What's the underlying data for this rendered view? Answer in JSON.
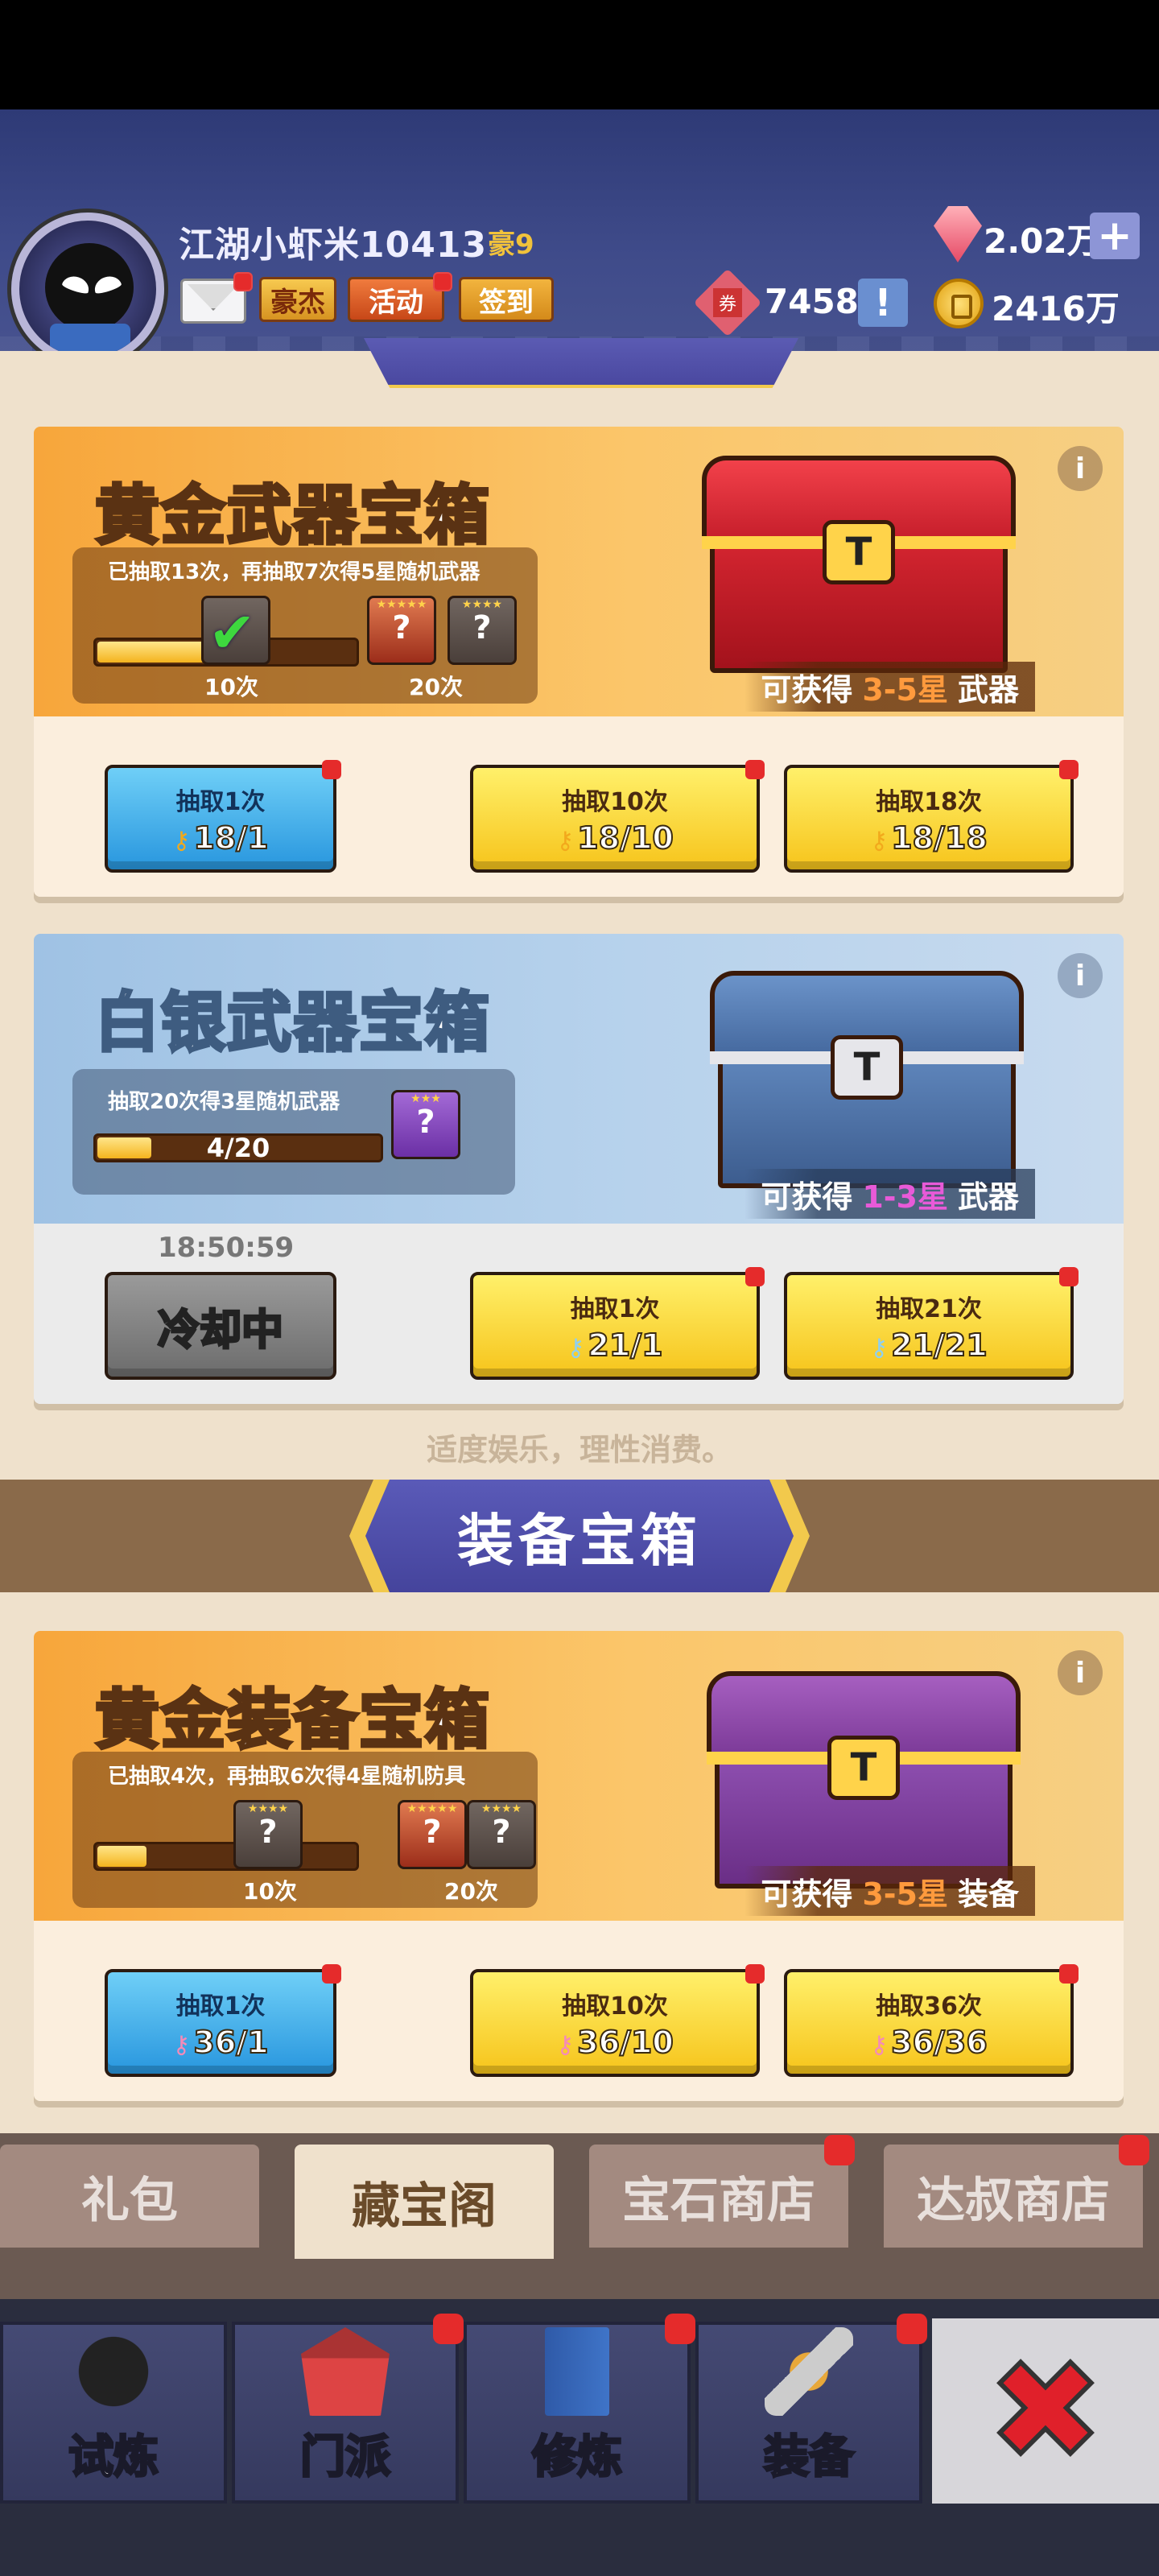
{
  "header": {
    "username": "江湖小虾米10413",
    "vip": "豪9",
    "buttons": {
      "hero": "豪杰",
      "activity": "活动",
      "signin": "签到"
    },
    "gems": "2.02万",
    "tickets": "7458",
    "coins": "2416万",
    "plus": "+",
    "excl": "!",
    "ticket_glyph": "券"
  },
  "cards": {
    "gold_weapon": {
      "title": "黄金武器宝箱",
      "progress_text": "已抽取13次，再抽取7次得5星随机武器",
      "progress": 0.65,
      "mark1": "10次",
      "mark2": "20次",
      "obtain_prefix": "可获得",
      "obtain_stars": "3-5星",
      "obtain_suffix": "武器",
      "btn1": {
        "label": "抽取1次",
        "cost": "18/1"
      },
      "btn2": {
        "label": "抽取10次",
        "cost": "18/10"
      },
      "btn3": {
        "label": "抽取18次",
        "cost": "18/18"
      }
    },
    "silver_weapon": {
      "title": "白银武器宝箱",
      "progress_text": "抽取20次得3星随机武器",
      "progress": 0.2,
      "progress_count": "4/20",
      "obtain_prefix": "可获得",
      "obtain_stars": "1-3星",
      "obtain_suffix": "武器",
      "cooldown_time": "18:50:59",
      "btn_cooldown": "冷却中",
      "btn2": {
        "label": "抽取1次",
        "cost": "21/1"
      },
      "btn3": {
        "label": "抽取21次",
        "cost": "21/21"
      }
    },
    "gold_equip": {
      "title": "黄金装备宝箱",
      "progress_text": "已抽取4次，再抽取6次得4星随机防具",
      "progress": 0.2,
      "mark1": "10次",
      "mark2": "20次",
      "obtain_prefix": "可获得",
      "obtain_stars": "3-5星",
      "obtain_suffix": "装备",
      "btn1": {
        "label": "抽取1次",
        "cost": "36/1"
      },
      "btn2": {
        "label": "抽取10次",
        "cost": "36/10"
      },
      "btn3": {
        "label": "抽取36次",
        "cost": "36/36"
      }
    }
  },
  "info_glyph": "i",
  "chest_glyph": "T",
  "slot_glyph": "?",
  "slot_count": "1",
  "check_glyph": "✔",
  "key_glyph": "⚷",
  "disclaimer": "适度娱乐，理性消费。",
  "section2_title": "装备宝箱",
  "tabs": [
    "礼包",
    "藏宝阁",
    "宝石商店",
    "达叔商店"
  ],
  "nav": [
    "试炼",
    "门派",
    "修炼",
    "装备"
  ],
  "close_glyph": "✖",
  "colors": {
    "gold_card": "#f7a63b",
    "silver_card": "#9fc2e4",
    "stars_orange": "#ff9a3d",
    "stars_pink": "#e85ad8",
    "badge_red": "#e52b2b"
  }
}
